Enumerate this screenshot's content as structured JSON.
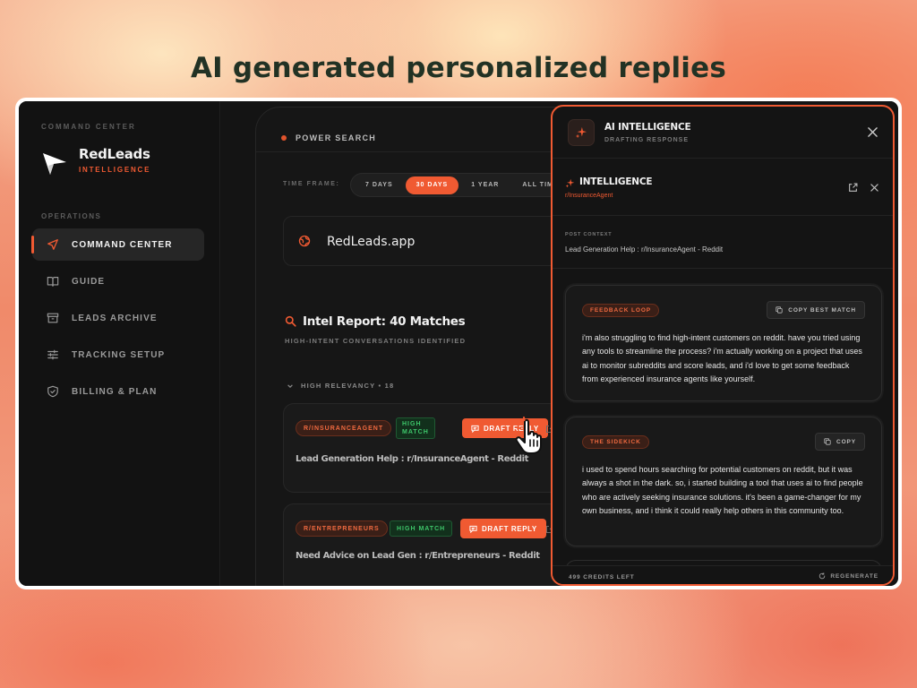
{
  "headline": "AI generated personalized replies",
  "colors": {
    "accent": "#f05a32",
    "match_green": "#3ec66a",
    "background_dark": "#121212"
  },
  "sidebar": {
    "section_top": "COMMAND CENTER",
    "brand": {
      "name": "RedLeads",
      "sub": "INTELLIGENCE"
    },
    "section_ops": "OPERATIONS",
    "items": [
      {
        "label": "COMMAND CENTER",
        "icon": "send-icon",
        "active": true
      },
      {
        "label": "GUIDE",
        "icon": "book-icon",
        "active": false
      },
      {
        "label": "LEADS ARCHIVE",
        "icon": "archive-icon",
        "active": false
      },
      {
        "label": "TRACKING SETUP",
        "icon": "sliders-icon",
        "active": false
      },
      {
        "label": "BILLING & PLAN",
        "icon": "shield-icon",
        "active": false
      }
    ]
  },
  "main": {
    "search_title": "POWER SEARCH",
    "time_frame_label": "TIME FRAME:",
    "time_frames": [
      "7 DAYS",
      "30 DAYS",
      "1 YEAR",
      "ALL TIME"
    ],
    "time_frame_selected": "30 DAYS",
    "site": "RedLeads.app",
    "report_title": "Intel Report: 40 Matches",
    "report_sub": "HIGH-INTENT CONVERSATIONS IDENTIFIED",
    "group_label": "HIGH RELEVANCY • 18",
    "leads": [
      {
        "subreddit": "R/INSURANCEAGENT",
        "match_line1": "HIGH",
        "match_line2": "MATCH",
        "action": "DRAFT REPLY",
        "title": "Lead Generation Help : r/InsuranceAgent - Reddit"
      },
      {
        "subreddit": "R/ENTREPRENEURS",
        "match": "HIGH MATCH",
        "action": "DRAFT REPLY",
        "title": "Need Advice on Lead Gen : r/Entrepreneurs - Reddit"
      }
    ]
  },
  "drawer": {
    "title": "AI INTELLIGENCE",
    "subtitle": "DRAFTING RESPONSE",
    "intel_title": "INTELLIGENCE",
    "intel_sub": "r/InsuranceAgent",
    "post_context_label": "POST CONTEXT",
    "post_context_value": "Lead Generation Help : r/InsuranceAgent - Reddit",
    "replies": [
      {
        "tag": "FEEDBACK LOOP",
        "copy_label": "COPY BEST MATCH",
        "text": "i'm also struggling to find high-intent customers on reddit. have you tried using any tools to streamline the process? i'm actually working on a project that uses ai to monitor subreddits and score leads, and i'd love to get some feedback from experienced insurance agents like yourself."
      },
      {
        "tag": "THE SIDEKICK",
        "copy_label": "COPY",
        "text": "i used to spend hours searching for potential customers on reddit, but it was always a shot in the dark. so, i started building a tool that uses ai to find people who are actively seeking insurance solutions. it's been a game-changer for my own business, and i think it could really help others in this community too."
      }
    ],
    "credits": "499 CREDITS LEFT",
    "regenerate": "REGENERATE"
  }
}
